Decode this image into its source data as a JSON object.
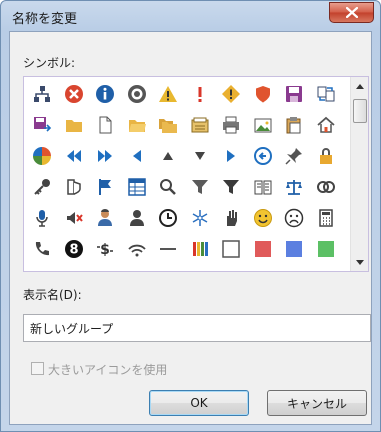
{
  "window": {
    "title": "名称を変更"
  },
  "symbols_label": "シンボル:",
  "display_name_label": "表示名(D):",
  "display_name_value": "新しいグループ",
  "large_icon_label": "大きいアイコンを使用",
  "large_icon_checked": false,
  "ok_label": "OK",
  "cancel_label": "キャンセル",
  "symbol_icons": [
    [
      "org-chart",
      "error-x",
      "info",
      "target",
      "warning",
      "exclamation",
      "diamond-warning",
      "shield",
      "save",
      "swap"
    ],
    [
      "save-arrow",
      "folder",
      "blank-page",
      "folder-open",
      "folders",
      "card-file",
      "printer",
      "picture",
      "clipboard",
      "home"
    ],
    [
      "pie-chart",
      "rewind",
      "fast-forward",
      "triangle-left",
      "triangle-up",
      "triangle-down",
      "triangle-right",
      "back-circle",
      "pushpin",
      "padlock"
    ],
    [
      "key",
      "phone-shield",
      "flag",
      "table",
      "magnifier",
      "funnel",
      "funnel-dark",
      "book",
      "scales",
      "rings"
    ],
    [
      "microphone",
      "mute",
      "person-user",
      "person",
      "clock",
      "snowflake",
      "hand",
      "smiley",
      "frown",
      "calculator"
    ],
    [
      "phone",
      "number-8",
      "dollar-arrows",
      "wifi",
      "dash",
      "color-bars",
      "white-square",
      "red-square",
      "blue-square",
      "green-square"
    ]
  ]
}
